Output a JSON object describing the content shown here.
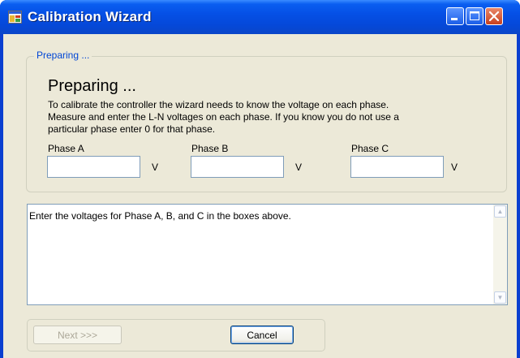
{
  "window": {
    "title": "Calibration Wizard"
  },
  "group": {
    "legend": "Preparing ..."
  },
  "step": {
    "heading": "Preparing ...",
    "description": "To calibrate the controller the wizard needs to know the voltage on each phase.\nMeasure and enter the L-N voltages on each phase.  If you know you do not use a\nparticular phase enter 0 for that phase."
  },
  "phases": [
    {
      "label": "Phase A",
      "value": "",
      "unit": "V"
    },
    {
      "label": "Phase B",
      "value": "",
      "unit": "V"
    },
    {
      "label": "Phase C",
      "value": "",
      "unit": "V"
    }
  ],
  "message": {
    "text": "Enter the voltages for Phase A, B, and C in the boxes above."
  },
  "buttons": {
    "next_label": "Next >>>",
    "next_enabled": false,
    "cancel_label": "Cancel"
  },
  "colors": {
    "title_bar": "#0550e6",
    "client_bg": "#ece9d8",
    "legend_text": "#0046d5",
    "close_button": "#c8401d"
  }
}
